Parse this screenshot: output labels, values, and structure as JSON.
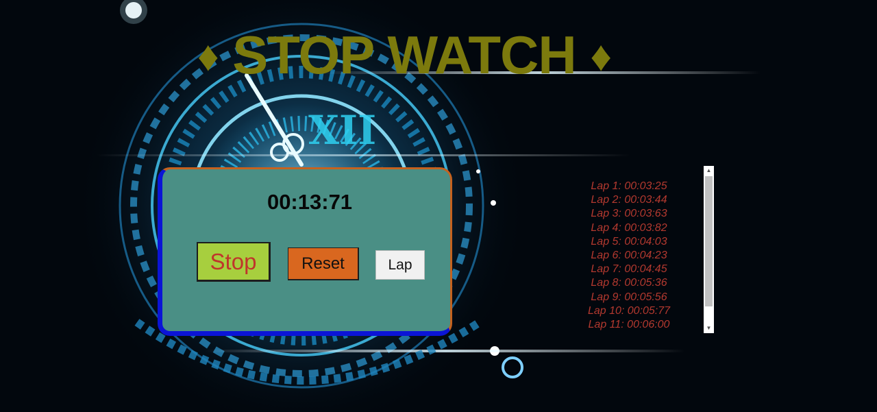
{
  "title": {
    "left_diamond": "♦",
    "text": "STOP WATCH",
    "right_diamond": "♦"
  },
  "timer": {
    "display": "00:13:71"
  },
  "buttons": {
    "stop_label": "Stop",
    "reset_label": "Reset",
    "lap_label": "Lap"
  },
  "laps": [
    "Lap 1: 00:03:25",
    "Lap 2: 00:03:44",
    "Lap 3: 00:03:63",
    "Lap 4: 00:03:82",
    "Lap 5: 00:04:03",
    "Lap 6: 00:04:23",
    "Lap 7: 00:04:45",
    "Lap 8: 00:05:36",
    "Lap 9: 00:05:56",
    "Lap 10: 00:05:77",
    "Lap 11: 00:06:00"
  ],
  "colors": {
    "title": "#7c7a0d",
    "panel": "#4a8f85",
    "panel_border_accent": "#0b14d6",
    "panel_border_secondary": "#c5621f",
    "stop_button_bg": "#a7cf3e",
    "stop_button_text": "#c0352b",
    "reset_button_bg": "#d9671f",
    "lap_text": "#b4392f"
  },
  "icons": {
    "scroll_up": "chevron-up-icon",
    "scroll_down": "chevron-down-icon",
    "background": "clock-face-illustration"
  }
}
